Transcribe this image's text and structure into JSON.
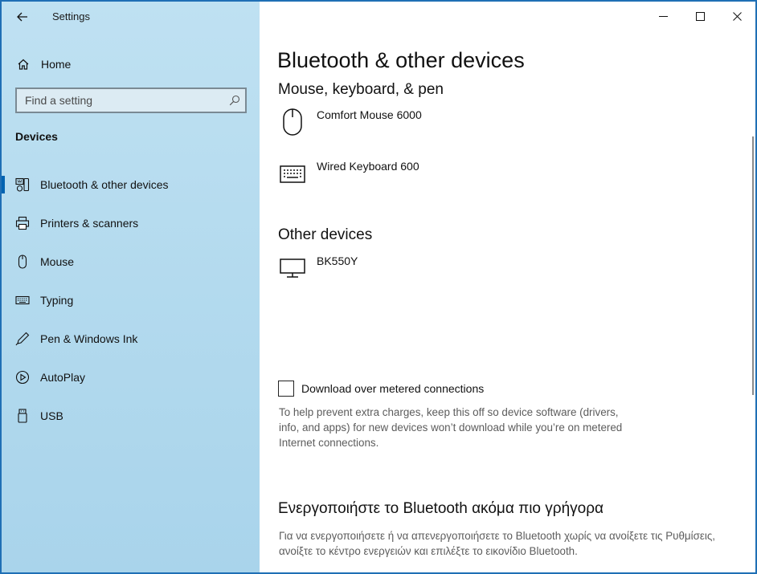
{
  "window": {
    "app_title": "Settings"
  },
  "sidebar": {
    "home_label": "Home",
    "search_placeholder": "Find a setting",
    "section_label": "Devices",
    "items": [
      {
        "label": "Bluetooth & other devices",
        "icon": "bluetooth-devices-icon",
        "active": true
      },
      {
        "label": "Printers & scanners",
        "icon": "printer-icon",
        "active": false
      },
      {
        "label": "Mouse",
        "icon": "mouse-icon",
        "active": false
      },
      {
        "label": "Typing",
        "icon": "keyboard-icon",
        "active": false
      },
      {
        "label": "Pen & Windows Ink",
        "icon": "pen-icon",
        "active": false
      },
      {
        "label": "AutoPlay",
        "icon": "autoplay-icon",
        "active": false
      },
      {
        "label": "USB",
        "icon": "usb-icon",
        "active": false
      }
    ]
  },
  "main": {
    "title": "Bluetooth & other devices",
    "mouse_section": {
      "heading": "Mouse, keyboard, & pen",
      "devices": [
        {
          "name": "Comfort Mouse 6000",
          "icon": "mouse-icon"
        },
        {
          "name": "Wired Keyboard 600",
          "icon": "keyboard-icon"
        }
      ]
    },
    "other_section": {
      "heading": "Other devices",
      "devices": [
        {
          "name": "BK550Y",
          "icon": "monitor-icon"
        }
      ]
    },
    "metered": {
      "label": "Download over metered connections",
      "checked": false,
      "description": "To help prevent extra charges, keep this off so device software (drivers, info, and apps) for new devices won’t download while you’re on metered Internet connections."
    },
    "quick_bt": {
      "heading": "Ενεργοποιήστε το Bluetooth ακόμα πιο γρήγορα",
      "description": "Για να ενεργοποιήσετε ή να απενεργοποιήσετε το Bluetooth χωρίς να ανοίξετε τις Ρυθμίσεις, ανοίξτε το κέντρο ενεργειών και επιλέξτε το εικονίδιο Bluetooth."
    }
  },
  "colors": {
    "accent": "#0063b1",
    "sidebar_bg": "#b3daee",
    "frame": "#1f6fb5"
  }
}
